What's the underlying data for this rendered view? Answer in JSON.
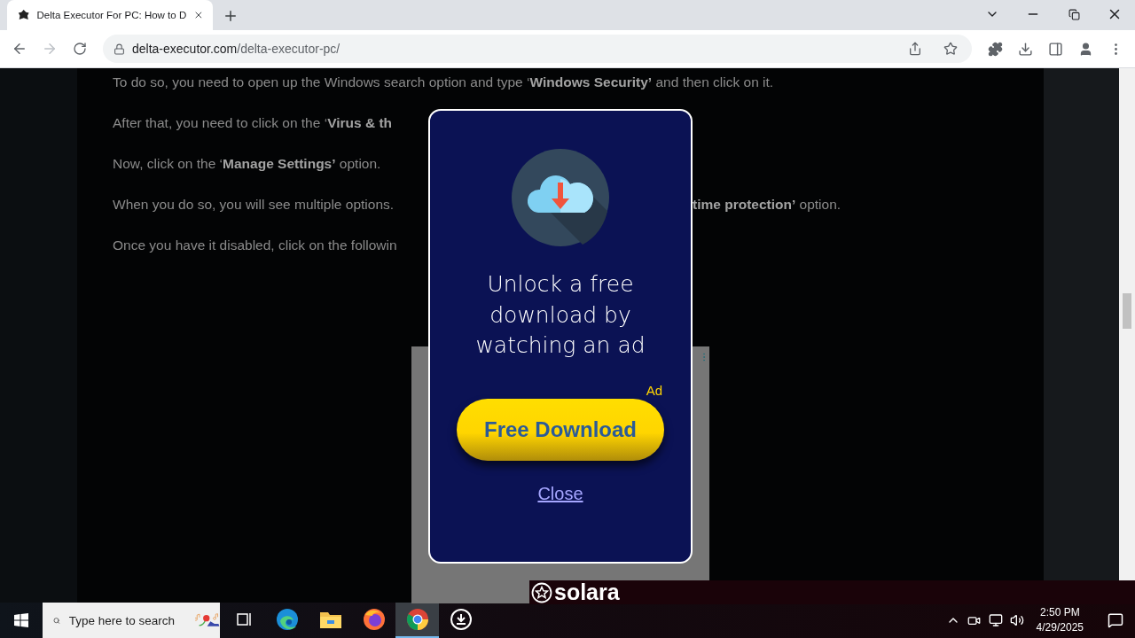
{
  "browser": {
    "tabs": [
      {
        "title": "Delta Executor For PC: How to D",
        "selected": true
      }
    ],
    "address": {
      "domain": "delta-executor.com",
      "path": "/delta-executor-pc/"
    }
  },
  "article": {
    "intro": "To do so, you need to open up the Windows search option and type ‘**Windows Security’** and then click on it.",
    "paragraphs": [
      {
        "left": "After that, you need to click on the ‘**Virus & th**"
      },
      {
        "left": "Now, click on the ‘**Manage Settings’** option."
      },
      {
        "left": "When you do so, you will see multiple options.",
        "right": "**time protection’** option."
      },
      {
        "left": "Once you have it disabled, click on the followin"
      }
    ]
  },
  "ad": {
    "title_lines": [
      "Unlock a free",
      "download by",
      "watching an ad"
    ],
    "badge": "Ad",
    "button": "Free Download",
    "close": "Close"
  },
  "banner": {
    "name": "solara"
  },
  "taskbar": {
    "search": {
      "placeholder": "Type here to search"
    },
    "apps": [
      {
        "kind": "task-view",
        "selected": false
      },
      {
        "kind": "edge",
        "selected": false
      },
      {
        "kind": "explorer",
        "selected": false
      },
      {
        "kind": "firefox",
        "selected": false
      },
      {
        "kind": "chrome",
        "selected": true
      },
      {
        "kind": "downloader",
        "selected": false
      }
    ],
    "clock": {
      "time": "2:50 PM",
      "date": "4/29/2025"
    }
  }
}
